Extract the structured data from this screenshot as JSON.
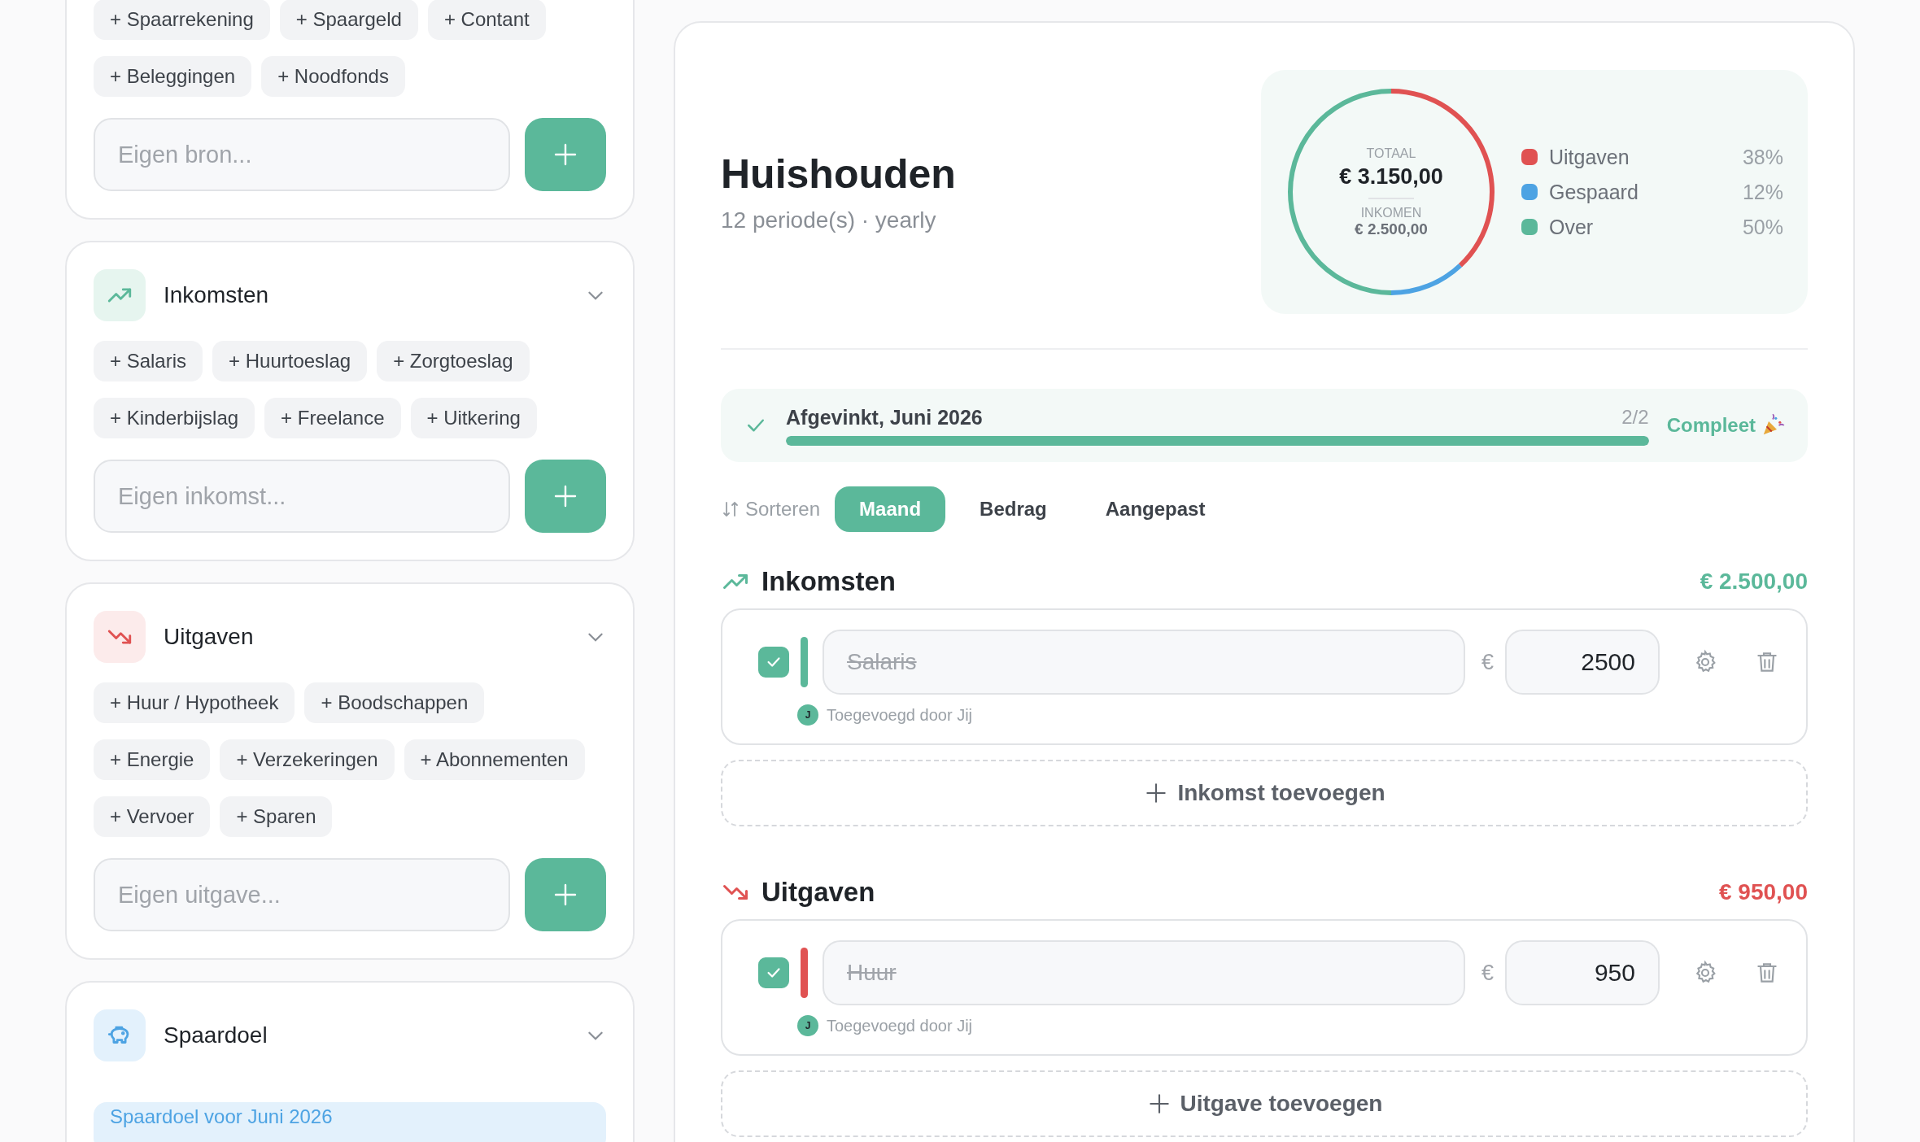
{
  "left_panel": {
    "sources_card": {
      "chips": [
        "+ Spaarrekening",
        "+ Spaargeld",
        "+ Contant",
        "+ Beleggingen",
        "+ Noodfonds"
      ],
      "input": {
        "placeholder": "Eigen bron..."
      }
    },
    "sections": [
      {
        "kind": "income",
        "title": "Inkomsten",
        "chips": [
          "+ Salaris",
          "+ Huurtoeslag",
          "+ Zorgtoeslag",
          "+ Kinderbijslag",
          "+ Freelance",
          "+ Uitkering"
        ],
        "input": {
          "placeholder": "Eigen inkomst..."
        }
      },
      {
        "kind": "expense",
        "title": "Uitgaven",
        "chips": [
          "+ Huur / Hypotheek",
          "+ Boodschappen",
          "+ Energie",
          "+ Verzekeringen",
          "+ Abonnementen",
          "+ Vervoer",
          "+ Sparen"
        ],
        "input": {
          "placeholder": "Eigen uitgave..."
        }
      },
      {
        "kind": "savings",
        "title": "Spaardoel",
        "banner": "Spaardoel voor Juni 2026"
      }
    ]
  },
  "budget": {
    "title": "Huishouden",
    "subtitle": "12 periode(s) · yearly",
    "summary": {
      "total_label": "TOTAAL",
      "total": "€ 3.150,00",
      "income_label": "INKOMEN",
      "income": "€ 2.500,00",
      "chart_data": {
        "type": "donut",
        "categories": [
          "Uitgaven",
          "Gespaard",
          "Over"
        ],
        "values": [
          38,
          12,
          50
        ]
      },
      "legend": [
        {
          "percent": "38%",
          "color": "#e05252"
        },
        {
          "percent": "12%",
          "color": "#4da3e3"
        },
        {
          "percent": "50%",
          "color": "#5bb89a"
        }
      ]
    },
    "progress": {
      "label": "Afgevinkt, Juni 2026",
      "count": "2/2",
      "level": 1,
      "status": "Compleet"
    },
    "sort": {
      "label": "Sorteren",
      "options": [
        {
          "label": "Maand",
          "selected": true
        },
        {
          "label": "Bedrag",
          "selected": false
        },
        {
          "label": "Aangepast",
          "selected": false
        }
      ]
    },
    "sections": [
      {
        "kind": "income",
        "title": "Inkomsten",
        "total": "€ 2.500,00",
        "items": [
          {
            "name": "Salaris",
            "checked": true,
            "currency": "€",
            "amount": "2500",
            "avatar": "J",
            "added_by": "Toegevoegd door Jij"
          }
        ],
        "add_label": "Inkomst toevoegen"
      },
      {
        "kind": "expense",
        "title": "Uitgaven",
        "total": "€ 950,00",
        "items": [
          {
            "name": "Huur",
            "checked": true,
            "currency": "€",
            "amount": "950",
            "avatar": "J",
            "added_by": "Toegevoegd door Jij"
          }
        ],
        "add_label": "Uitgave toevoegen"
      }
    ]
  }
}
